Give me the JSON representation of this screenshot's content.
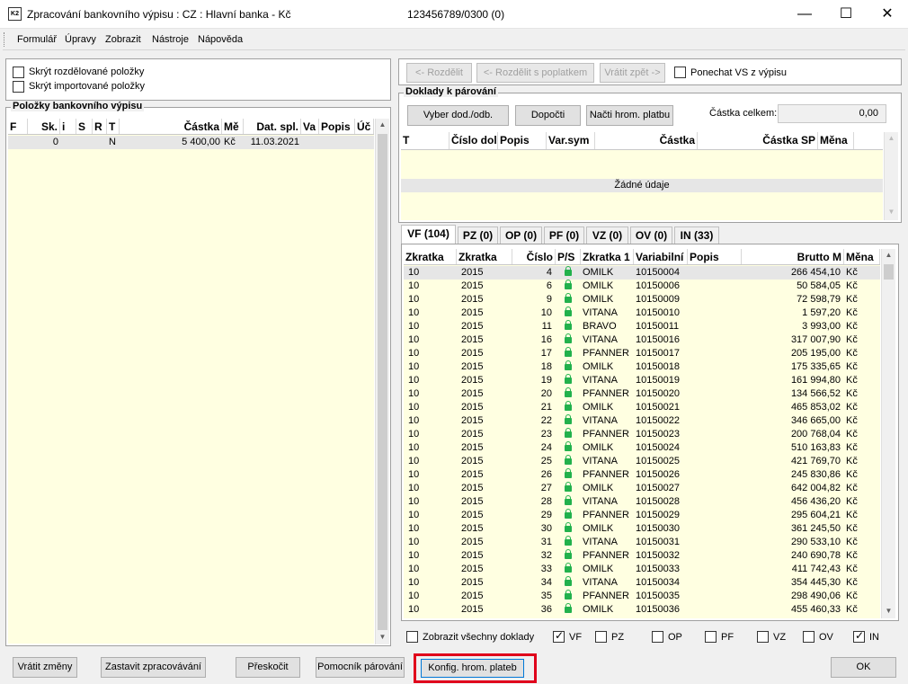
{
  "window": {
    "title": "Zpracování bankovního výpisu : CZ : Hlavní banka - Kč",
    "account": "123456789/0300 (0)",
    "icon_text": "K2"
  },
  "menu": [
    {
      "label": "Formulář",
      "key": "F"
    },
    {
      "label": "Úpravy",
      "key": "Ú"
    },
    {
      "label": "Zobrazit",
      "key": "Z"
    },
    {
      "label": "Nástroje",
      "key": "N"
    },
    {
      "label": "Nápověda",
      "key": "N"
    }
  ],
  "filters": {
    "hide_split": "Skrýt rozdělované položky",
    "hide_imported": "Skrýt importované položky"
  },
  "left_table": {
    "title": "Položky bankovního výpisu",
    "columns": [
      "F",
      "Sk.",
      "i",
      "S",
      "R",
      "T",
      "Částka",
      "Mě",
      "Dat. spl.",
      "Va",
      "Popis",
      "Úč"
    ],
    "rows": [
      {
        "F": "",
        "Sk": "0",
        "i": "",
        "S": "",
        "R": "",
        "T": "N",
        "castka": "5 400,00",
        "mena": "Kč",
        "datum": "11.03.2021",
        "va": "",
        "popis": "",
        "uc": ""
      }
    ]
  },
  "toolbar": {
    "rozdelit": "<- Rozdělit",
    "rozdelit_poplatek": "<- Rozdělit s poplatkem",
    "vratit_zpet": "Vrátit zpět ->",
    "ponechat_vs": "Ponechat VS z výpisu"
  },
  "pairing": {
    "title": "Doklady k párování",
    "btn_vyber": "Vyber dod./odb.",
    "btn_dopocti": "Dopočti",
    "btn_nacti": "Načti hrom. platbu",
    "total_label": "Částka celkem:",
    "total_value": "0,00",
    "columns": [
      "T",
      "Číslo dol",
      "Popis",
      "Var.sym",
      "Částka",
      "Částka SP",
      "Měna"
    ],
    "empty": "Žádné údaje"
  },
  "tabs": [
    "VF (104)",
    "PZ (0)",
    "OP (0)",
    "PF (0)",
    "VZ (0)",
    "OV (0)",
    "IN (33)"
  ],
  "doc_table": {
    "columns": [
      "Zkratka",
      "Zkratka",
      "Číslo",
      "P/S",
      "Zkratka 1",
      "Variabilní",
      "Popis",
      "Brutto M",
      "Měna"
    ],
    "rows": [
      {
        "z1": "10",
        "z2": "2015",
        "c": "4",
        "z3": "OMILK",
        "vs": "10150004",
        "b": "266 454,10",
        "m": "Kč"
      },
      {
        "z1": "10",
        "z2": "2015",
        "c": "6",
        "z3": "OMILK",
        "vs": "10150006",
        "b": "50 584,05",
        "m": "Kč"
      },
      {
        "z1": "10",
        "z2": "2015",
        "c": "9",
        "z3": "OMILK",
        "vs": "10150009",
        "b": "72 598,79",
        "m": "Kč"
      },
      {
        "z1": "10",
        "z2": "2015",
        "c": "10",
        "z3": "VITANA",
        "vs": "10150010",
        "b": "1 597,20",
        "m": "Kč"
      },
      {
        "z1": "10",
        "z2": "2015",
        "c": "11",
        "z3": "BRAVO",
        "vs": "10150011",
        "b": "3 993,00",
        "m": "Kč"
      },
      {
        "z1": "10",
        "z2": "2015",
        "c": "16",
        "z3": "VITANA",
        "vs": "10150016",
        "b": "317 007,90",
        "m": "Kč"
      },
      {
        "z1": "10",
        "z2": "2015",
        "c": "17",
        "z3": "PFANNER",
        "vs": "10150017",
        "b": "205 195,00",
        "m": "Kč"
      },
      {
        "z1": "10",
        "z2": "2015",
        "c": "18",
        "z3": "OMILK",
        "vs": "10150018",
        "b": "175 335,65",
        "m": "Kč"
      },
      {
        "z1": "10",
        "z2": "2015",
        "c": "19",
        "z3": "VITANA",
        "vs": "10150019",
        "b": "161 994,80",
        "m": "Kč"
      },
      {
        "z1": "10",
        "z2": "2015",
        "c": "20",
        "z3": "PFANNER",
        "vs": "10150020",
        "b": "134 566,52",
        "m": "Kč"
      },
      {
        "z1": "10",
        "z2": "2015",
        "c": "21",
        "z3": "OMILK",
        "vs": "10150021",
        "b": "465 853,02",
        "m": "Kč"
      },
      {
        "z1": "10",
        "z2": "2015",
        "c": "22",
        "z3": "VITANA",
        "vs": "10150022",
        "b": "346 665,00",
        "m": "Kč"
      },
      {
        "z1": "10",
        "z2": "2015",
        "c": "23",
        "z3": "PFANNER",
        "vs": "10150023",
        "b": "200 768,04",
        "m": "Kč"
      },
      {
        "z1": "10",
        "z2": "2015",
        "c": "24",
        "z3": "OMILK",
        "vs": "10150024",
        "b": "510 163,83",
        "m": "Kč"
      },
      {
        "z1": "10",
        "z2": "2015",
        "c": "25",
        "z3": "VITANA",
        "vs": "10150025",
        "b": "421 769,70",
        "m": "Kč"
      },
      {
        "z1": "10",
        "z2": "2015",
        "c": "26",
        "z3": "PFANNER",
        "vs": "10150026",
        "b": "245 830,86",
        "m": "Kč"
      },
      {
        "z1": "10",
        "z2": "2015",
        "c": "27",
        "z3": "OMILK",
        "vs": "10150027",
        "b": "642 004,82",
        "m": "Kč"
      },
      {
        "z1": "10",
        "z2": "2015",
        "c": "28",
        "z3": "VITANA",
        "vs": "10150028",
        "b": "456 436,20",
        "m": "Kč"
      },
      {
        "z1": "10",
        "z2": "2015",
        "c": "29",
        "z3": "PFANNER",
        "vs": "10150029",
        "b": "295 604,21",
        "m": "Kč"
      },
      {
        "z1": "10",
        "z2": "2015",
        "c": "30",
        "z3": "OMILK",
        "vs": "10150030",
        "b": "361 245,50",
        "m": "Kč"
      },
      {
        "z1": "10",
        "z2": "2015",
        "c": "31",
        "z3": "VITANA",
        "vs": "10150031",
        "b": "290 533,10",
        "m": "Kč"
      },
      {
        "z1": "10",
        "z2": "2015",
        "c": "32",
        "z3": "PFANNER",
        "vs": "10150032",
        "b": "240 690,78",
        "m": "Kč"
      },
      {
        "z1": "10",
        "z2": "2015",
        "c": "33",
        "z3": "OMILK",
        "vs": "10150033",
        "b": "411 742,43",
        "m": "Kč"
      },
      {
        "z1": "10",
        "z2": "2015",
        "c": "34",
        "z3": "VITANA",
        "vs": "10150034",
        "b": "354 445,30",
        "m": "Kč"
      },
      {
        "z1": "10",
        "z2": "2015",
        "c": "35",
        "z3": "PFANNER",
        "vs": "10150035",
        "b": "298 490,06",
        "m": "Kč"
      },
      {
        "z1": "10",
        "z2": "2015",
        "c": "36",
        "z3": "OMILK",
        "vs": "10150036",
        "b": "455 460,33",
        "m": "Kč"
      }
    ]
  },
  "doc_filters": {
    "all_label": "Zobrazit všechny doklady",
    "items": [
      {
        "label": "VF",
        "checked": true
      },
      {
        "label": "PZ",
        "checked": false
      },
      {
        "label": "OP",
        "checked": false
      },
      {
        "label": "PF",
        "checked": false
      },
      {
        "label": "VZ",
        "checked": false
      },
      {
        "label": "OV",
        "checked": false
      },
      {
        "label": "IN",
        "checked": true
      }
    ]
  },
  "bottom": {
    "vratit": "Vrátit změny",
    "zastavit": "Zastavit zpracovávání",
    "preskocit": "Přeskočit",
    "pomocnik": "Pomocník párování",
    "konfig": "Konfig. hrom. plateb",
    "ok": "OK"
  },
  "colors": {
    "highlight": "#e0001b",
    "lock": "#22b14c",
    "grid_bg": "#ffffe1"
  }
}
